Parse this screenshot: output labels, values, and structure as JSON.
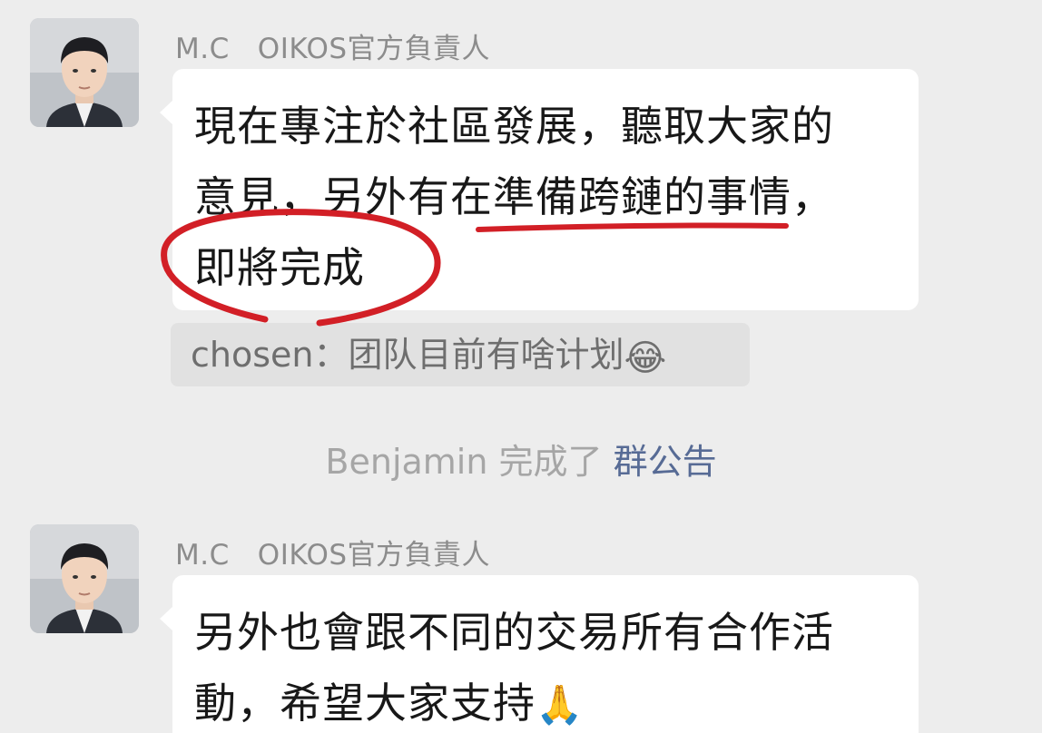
{
  "chat": {
    "messages": [
      {
        "sender": "M.C   OIKOS官方負責人",
        "lines": [
          "現在專注於社區發展，聽取大家的",
          "意見，另外有在準備跨鏈的事情，",
          "即將完成"
        ],
        "quote": {
          "author": "chosen",
          "separator": "：",
          "text": "团队目前有啥计划",
          "emoji": "😂"
        }
      },
      {
        "sender": "M.C   OIKOS官方負責人",
        "lines": [
          "另外也會跟不同的交易所有合作活",
          "動，希望大家支持"
        ],
        "emoji": "🙏"
      }
    ],
    "system_notice": {
      "actor": "Benjamin",
      "action": "完成了",
      "link": "群公告"
    }
  },
  "colors": {
    "background": "#ededed",
    "bubble": "#ffffff",
    "quote_bg": "#e1e1e1",
    "link": "#576b95",
    "annotation": "#d21f26"
  }
}
